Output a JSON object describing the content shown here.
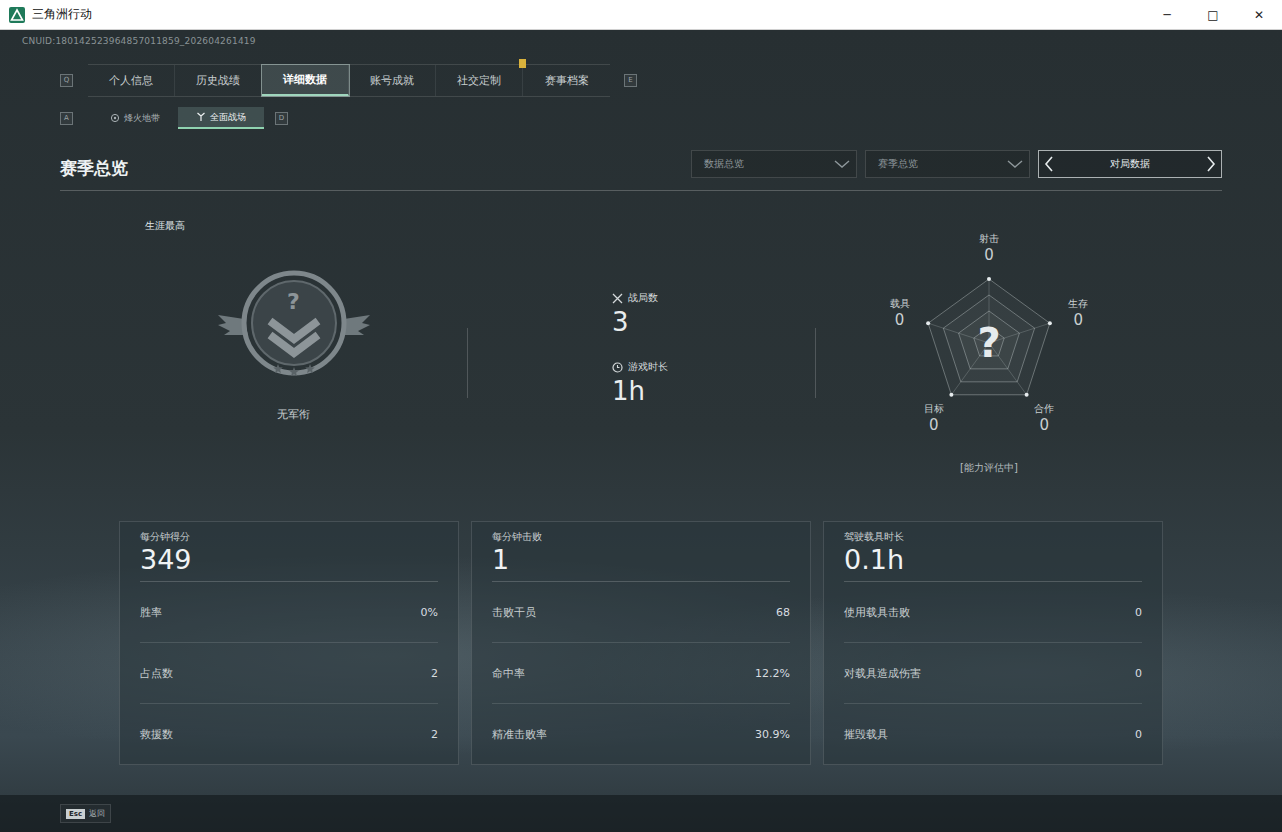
{
  "window": {
    "title": "三角洲行动",
    "controls": [
      "─",
      "□",
      "✕"
    ]
  },
  "uid": "CNUID:180142523964857011859_202604261419",
  "tabs": {
    "prev_key": "Q",
    "next_key": "E",
    "items": [
      {
        "label": "个人信息",
        "selected": false,
        "badge": false
      },
      {
        "label": "历史战绩",
        "selected": false,
        "badge": false
      },
      {
        "label": "详细数据",
        "selected": true,
        "badge": false
      },
      {
        "label": "账号成就",
        "selected": false,
        "badge": false
      },
      {
        "label": "社交定制",
        "selected": false,
        "badge": true
      },
      {
        "label": "赛事档案",
        "selected": false,
        "badge": false
      }
    ]
  },
  "mode_tabs": {
    "prev_key": "A",
    "next_key": "D",
    "items": [
      {
        "label": "烽火地带",
        "selected": false
      },
      {
        "label": "全面战场",
        "selected": true
      }
    ]
  },
  "section": {
    "title": "赛季总览",
    "filters": [
      "数据总览",
      "赛季总览"
    ],
    "switcher": "对局数据"
  },
  "rank": {
    "caption": "生涯最高",
    "mark": "?",
    "name": "无军衔"
  },
  "overview": [
    {
      "label": "战局数",
      "value": "3"
    },
    {
      "label": "游戏时长",
      "value": "1h"
    }
  ],
  "radar": {
    "center_mark": "?",
    "status": "[能力评估中]",
    "axes": [
      {
        "label": "射击",
        "value": "0"
      },
      {
        "label": "生存",
        "value": "0"
      },
      {
        "label": "合作",
        "value": "0"
      },
      {
        "label": "目标",
        "value": "0"
      },
      {
        "label": "载具",
        "value": "0"
      }
    ]
  },
  "cards": [
    {
      "title": "每分钟得分",
      "value": "349",
      "rows": [
        {
          "label": "胜率",
          "value": "0%"
        },
        {
          "label": "占点数",
          "value": "2"
        },
        {
          "label": "救援数",
          "value": "2"
        }
      ]
    },
    {
      "title": "每分钟击败",
      "value": "1",
      "rows": [
        {
          "label": "击败干员",
          "value": "68"
        },
        {
          "label": "命中率",
          "value": "12.2%"
        },
        {
          "label": "精准击败率",
          "value": "30.9%"
        }
      ]
    },
    {
      "title": "驾驶载具时长",
      "value": "0.1h",
      "rows": [
        {
          "label": "使用载具击败",
          "value": "0"
        },
        {
          "label": "对载具造成伤害",
          "value": "0"
        },
        {
          "label": "摧毁载具",
          "value": "0"
        }
      ]
    }
  ],
  "footer": {
    "key": "Esc",
    "label": "返回"
  }
}
